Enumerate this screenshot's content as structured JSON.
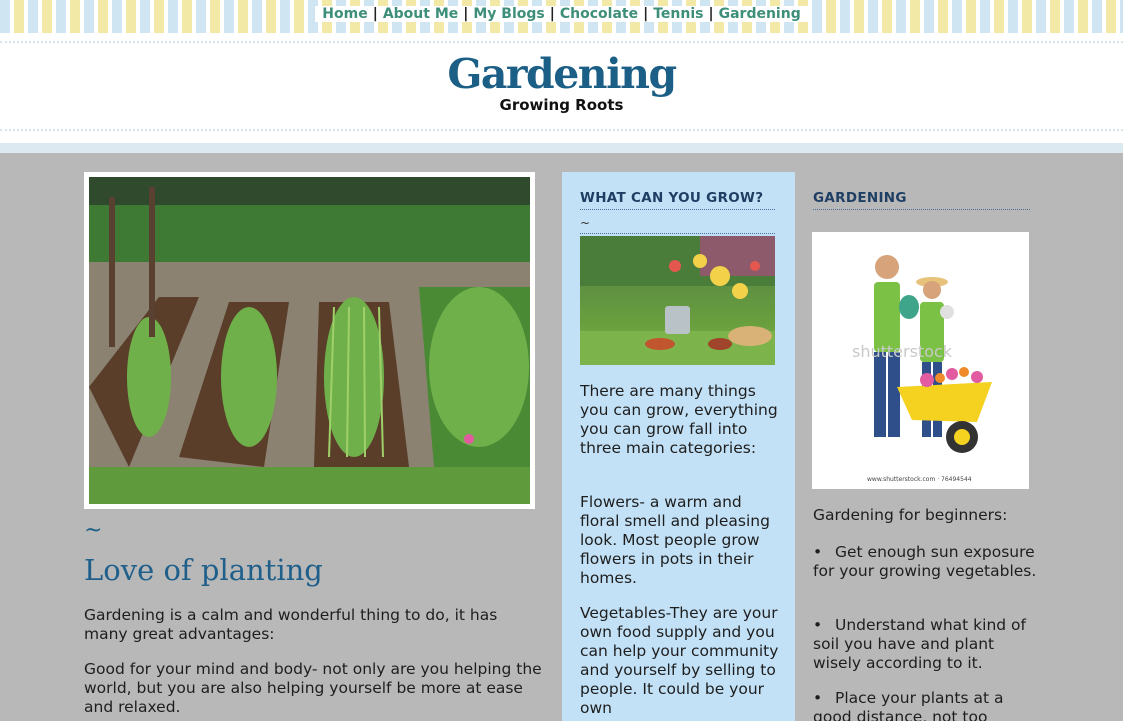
{
  "nav": {
    "items": [
      "Home",
      "About Me",
      "My Blogs",
      "Chocolate",
      "Tennis",
      "Gardening"
    ],
    "separator": "|"
  },
  "header": {
    "title": "Gardening",
    "subtitle": "Growing Roots"
  },
  "main": {
    "image_icon": "garden-beds-photo",
    "tilde": "~",
    "title": "Love of planting",
    "paragraphs": [
      "Gardening is a calm and wonderful thing to do, it has many great advantages:",
      "Good for your mind and body- not only are you helping the world, but you are also helping yourself be more at ease and relaxed."
    ]
  },
  "sidebar_mid": {
    "heading": "WHAT CAN YOU GROW?",
    "tilde": "~",
    "image_icon": "garden-tools-flowers-photo",
    "paragraphs": [
      "There are many things you can grow, everything you can grow fall into three main categories:",
      "Flowers- a warm and floral smell and pleasing look. Most people grow flowers in pots in their homes.",
      "Vegetables-They are your own food supply and you can help your community and yourself by selling to people. It could be your own"
    ]
  },
  "sidebar_right": {
    "heading": "GARDENING",
    "image_icon": "gardeners-wheelbarrow-photo",
    "image_watermark": "shutterstock",
    "image_caption": "www.shutterstock.com · 76494544",
    "intro": "Gardening for beginners:",
    "tips": [
      "Get enough sun exposure for your growing vegetables.",
      "Understand what kind of soil you have and plant wisely according to it.",
      "Place your plants at a good distance, not too"
    ]
  },
  "colors": {
    "background": "#b8b8b8",
    "nav_link": "#3d8f7a",
    "title_blue": "#1c5f86",
    "sidebar_blue": "#c3e1f6",
    "heading_navy": "#1e3f63"
  }
}
